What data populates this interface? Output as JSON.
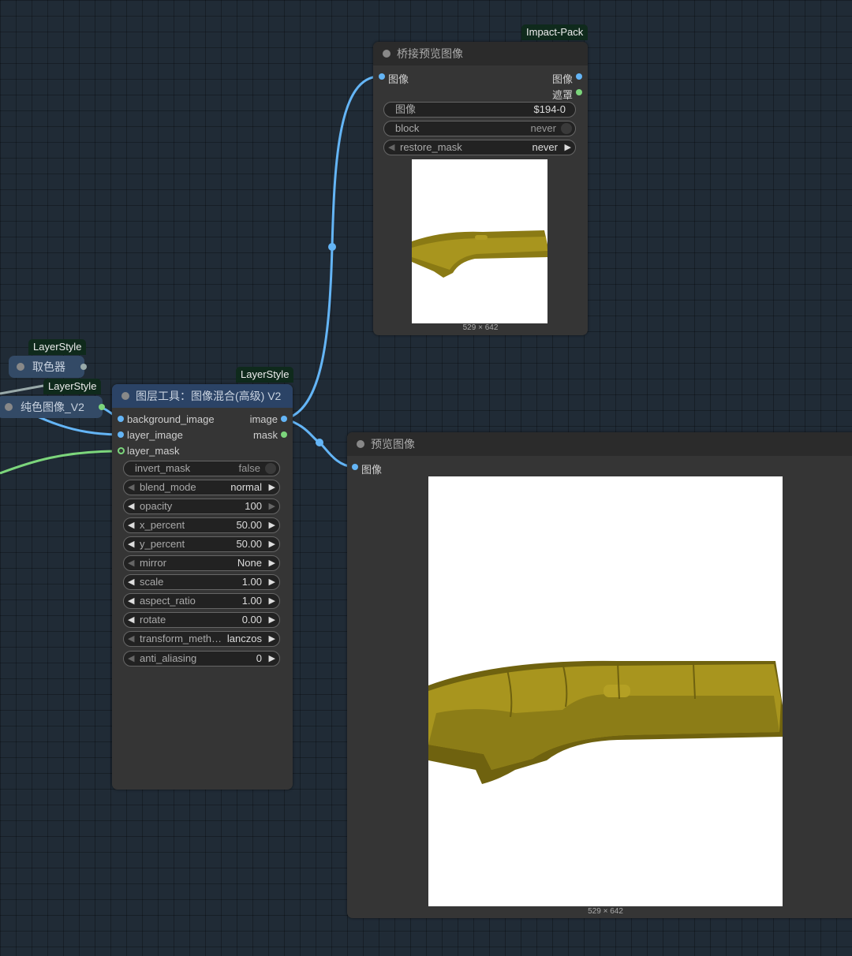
{
  "colors": {
    "canvas": "#202b36",
    "node_bg": "#353535",
    "node_header": "#2b2b2b",
    "node_header_blue": "#2b4366",
    "tag_bg": "#0f2a1c",
    "image_wire": "#64b5f6",
    "mask_wire": "#7cd67c"
  },
  "tags": {
    "impact_pack": "Impact-Pack",
    "layerstyle_a": "LayerStyle",
    "layerstyle_b": "LayerStyle",
    "layerstyle_c": "LayerStyle"
  },
  "bridge_node": {
    "title": "桥接预览图像",
    "input_image": "图像",
    "output_image": "图像",
    "output_mask": "遮罩",
    "widgets": {
      "image": {
        "label": "图像",
        "value": "$194-0"
      },
      "block": {
        "label": "block",
        "value": "never"
      },
      "restore_mask": {
        "label": "restore_mask",
        "value": "never"
      }
    },
    "size_label": "529 × 642"
  },
  "color_picker_node": {
    "title": "取色器"
  },
  "solid_image_node": {
    "title": "纯色图像_V2"
  },
  "blend_node": {
    "title": "图层工具：图像混合(高级) V2",
    "inputs": [
      "background_image",
      "layer_image",
      "layer_mask"
    ],
    "outputs": [
      "image",
      "mask"
    ],
    "widgets": [
      {
        "label": "invert_mask",
        "value": "false"
      },
      {
        "label": "blend_mode",
        "value": "normal"
      },
      {
        "label": "opacity",
        "value": "100"
      },
      {
        "label": "x_percent",
        "value": "50.00"
      },
      {
        "label": "y_percent",
        "value": "50.00"
      },
      {
        "label": "mirror",
        "value": "None"
      },
      {
        "label": "scale",
        "value": "1.00"
      },
      {
        "label": "aspect_ratio",
        "value": "1.00"
      },
      {
        "label": "rotate",
        "value": "0.00"
      },
      {
        "label": "transform_meth…",
        "value": "lanczos"
      },
      {
        "label": "anti_aliasing",
        "value": "0"
      }
    ]
  },
  "preview_node": {
    "title": "预览图像",
    "input_image": "图像",
    "size_label": "529 × 642"
  },
  "icons": {
    "left_arrow": "◀",
    "right_arrow": "▶",
    "status_dot": "status-dot-icon"
  }
}
